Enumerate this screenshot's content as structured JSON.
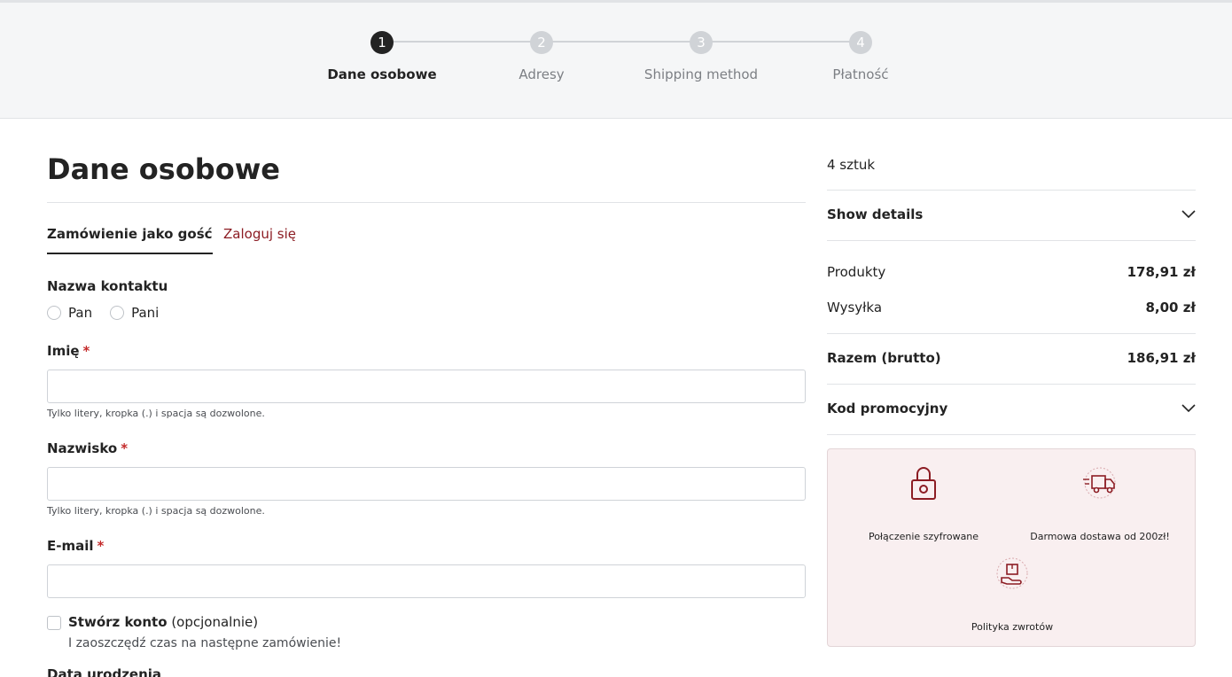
{
  "stepper": {
    "steps": [
      {
        "number": "1",
        "label": "Dane osobowe",
        "active": true
      },
      {
        "number": "2",
        "label": "Adresy",
        "active": false
      },
      {
        "number": "3",
        "label": "Shipping method",
        "active": false
      },
      {
        "number": "4",
        "label": "Płatność",
        "active": false
      }
    ]
  },
  "form": {
    "title": "Dane osobowe",
    "tabs": {
      "guest": "Zamówienie jako gość",
      "login": "Zaloguj się"
    },
    "contact_name": {
      "label": "Nazwa kontaktu",
      "options": [
        "Pan",
        "Pani"
      ]
    },
    "first_name": {
      "label": "Imię",
      "required_mark": "*",
      "value": "",
      "help": "Tylko litery, kropka (.) i spacja są dozwolone."
    },
    "last_name": {
      "label": "Nazwisko",
      "required_mark": "*",
      "value": "",
      "help": "Tylko litery, kropka (.) i spacja są dozwolone."
    },
    "email": {
      "label": "E-mail",
      "required_mark": "*",
      "value": ""
    },
    "create_account": {
      "label": "Stwórz konto",
      "optional": "(opcjonalnie)",
      "subtext": "I zaoszczędź czas na następne zamówienie!"
    },
    "birthdate_label": "Data urodzenia"
  },
  "summary": {
    "items_count": "4 sztuk",
    "show_details": "Show details",
    "products": {
      "label": "Produkty",
      "value": "178,91 zł"
    },
    "shipping": {
      "label": "Wysyłka",
      "value": "8,00 zł"
    },
    "total": {
      "label": "Razem (brutto)",
      "value": "186,91 zł"
    },
    "promo": "Kod promocyjny"
  },
  "trust": {
    "secure": "Połączenie szyfrowane",
    "free_shipping": "Darmowa dostawa od 200zł!",
    "returns": "Polityka zwrotów"
  },
  "colors": {
    "accent": "#8c1c23",
    "active_step": "#232323",
    "inactive_step": "#d0d3d7",
    "trust_bg": "#f9eff0"
  }
}
